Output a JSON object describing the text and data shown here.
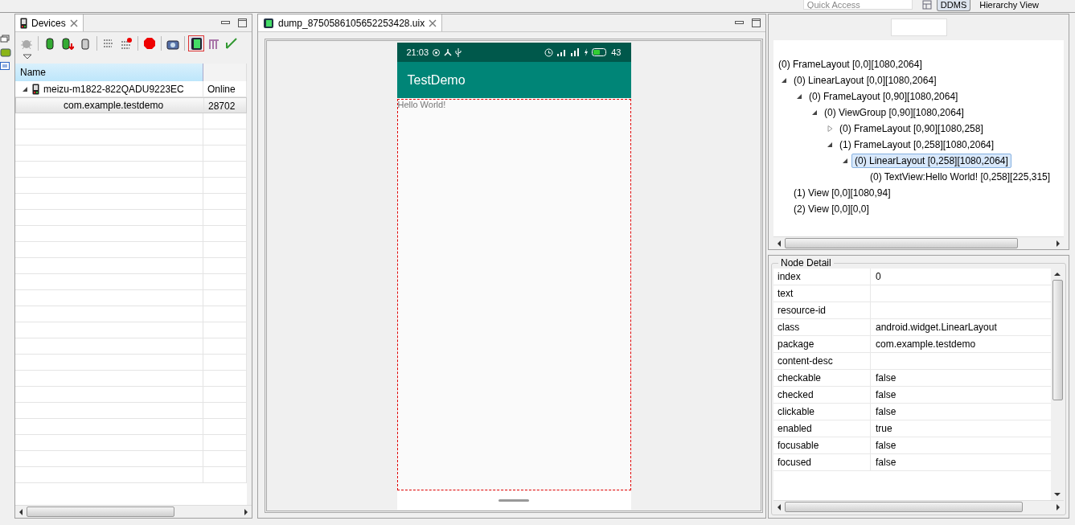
{
  "top_bar": {
    "quick_access": {
      "placeholder": "Quick Access"
    },
    "perspectives": [
      {
        "label": "DDMS",
        "selected": true
      },
      {
        "label": "Hierarchy View",
        "selected": false
      }
    ]
  },
  "devices_panel": {
    "tab": {
      "label": "Devices",
      "selected": true
    },
    "columns": [
      "Name"
    ],
    "rows": [
      {
        "kind": "device",
        "name": "meizu-m1822-822QADU9223EC",
        "column_2": "Online",
        "expanded": true,
        "selected": false
      },
      {
        "kind": "app",
        "name": "com.example.testdemo",
        "column_2": "28702",
        "selected": true
      }
    ]
  },
  "dump_panel": {
    "tab": {
      "label": "dump_8750586105652253428.uix",
      "selected": true
    },
    "phone": {
      "time": "21:03",
      "battery": "43",
      "app_title": "TestDemo",
      "content_text": "Hello World!"
    }
  },
  "hierarchy": {
    "nodes": [
      {
        "label": "(0) FrameLayout [0,0][1080,2064]",
        "selected": false,
        "children": [
          {
            "label": "(0) LinearLayout [0,0][1080,2064]",
            "expanded": true,
            "selected": false,
            "children": [
              {
                "label": "(0) FrameLayout [0,90][1080,2064]",
                "expanded": true,
                "selected": false,
                "children": [
                  {
                    "label": "(0) ViewGroup [0,90][1080,2064]",
                    "expanded": true,
                    "selected": false,
                    "children": [
                      {
                        "label": "(0) FrameLayout [0,90][1080,258]",
                        "expanded": false,
                        "selected": false
                      },
                      {
                        "label": "(1) FrameLayout [0,258][1080,2064]",
                        "expanded": true,
                        "selected": false,
                        "children": [
                          {
                            "label": "(0) LinearLayout [0,258][1080,2064]",
                            "expanded": true,
                            "selected": true,
                            "children": [
                              {
                                "label": "(0) TextView:Hello World! [0,258][225,315]",
                                "selected": false
                              }
                            ]
                          }
                        ]
                      }
                    ]
                  }
                ]
              }
            ]
          },
          {
            "label": "(1) View [0,0][1080,94]",
            "selected": false
          },
          {
            "label": "(2) View [0,0][0,0]",
            "selected": false
          }
        ]
      }
    ]
  },
  "node_detail": {
    "title": "Node Detail",
    "rows": [
      {
        "key": "index",
        "value": "0"
      },
      {
        "key": "text"
      },
      {
        "key": "resource-id"
      },
      {
        "key": "class",
        "value": "android.widget.LinearLayout"
      },
      {
        "key": "package",
        "value": "com.example.testdemo"
      },
      {
        "key": "content-desc"
      },
      {
        "key": "checkable",
        "value": "false"
      },
      {
        "key": "checked",
        "value": "false"
      },
      {
        "key": "clickable",
        "value": "false"
      },
      {
        "key": "enabled",
        "value": "true"
      },
      {
        "key": "focusable",
        "value": "false"
      },
      {
        "key": "focused",
        "value": "false"
      }
    ]
  }
}
